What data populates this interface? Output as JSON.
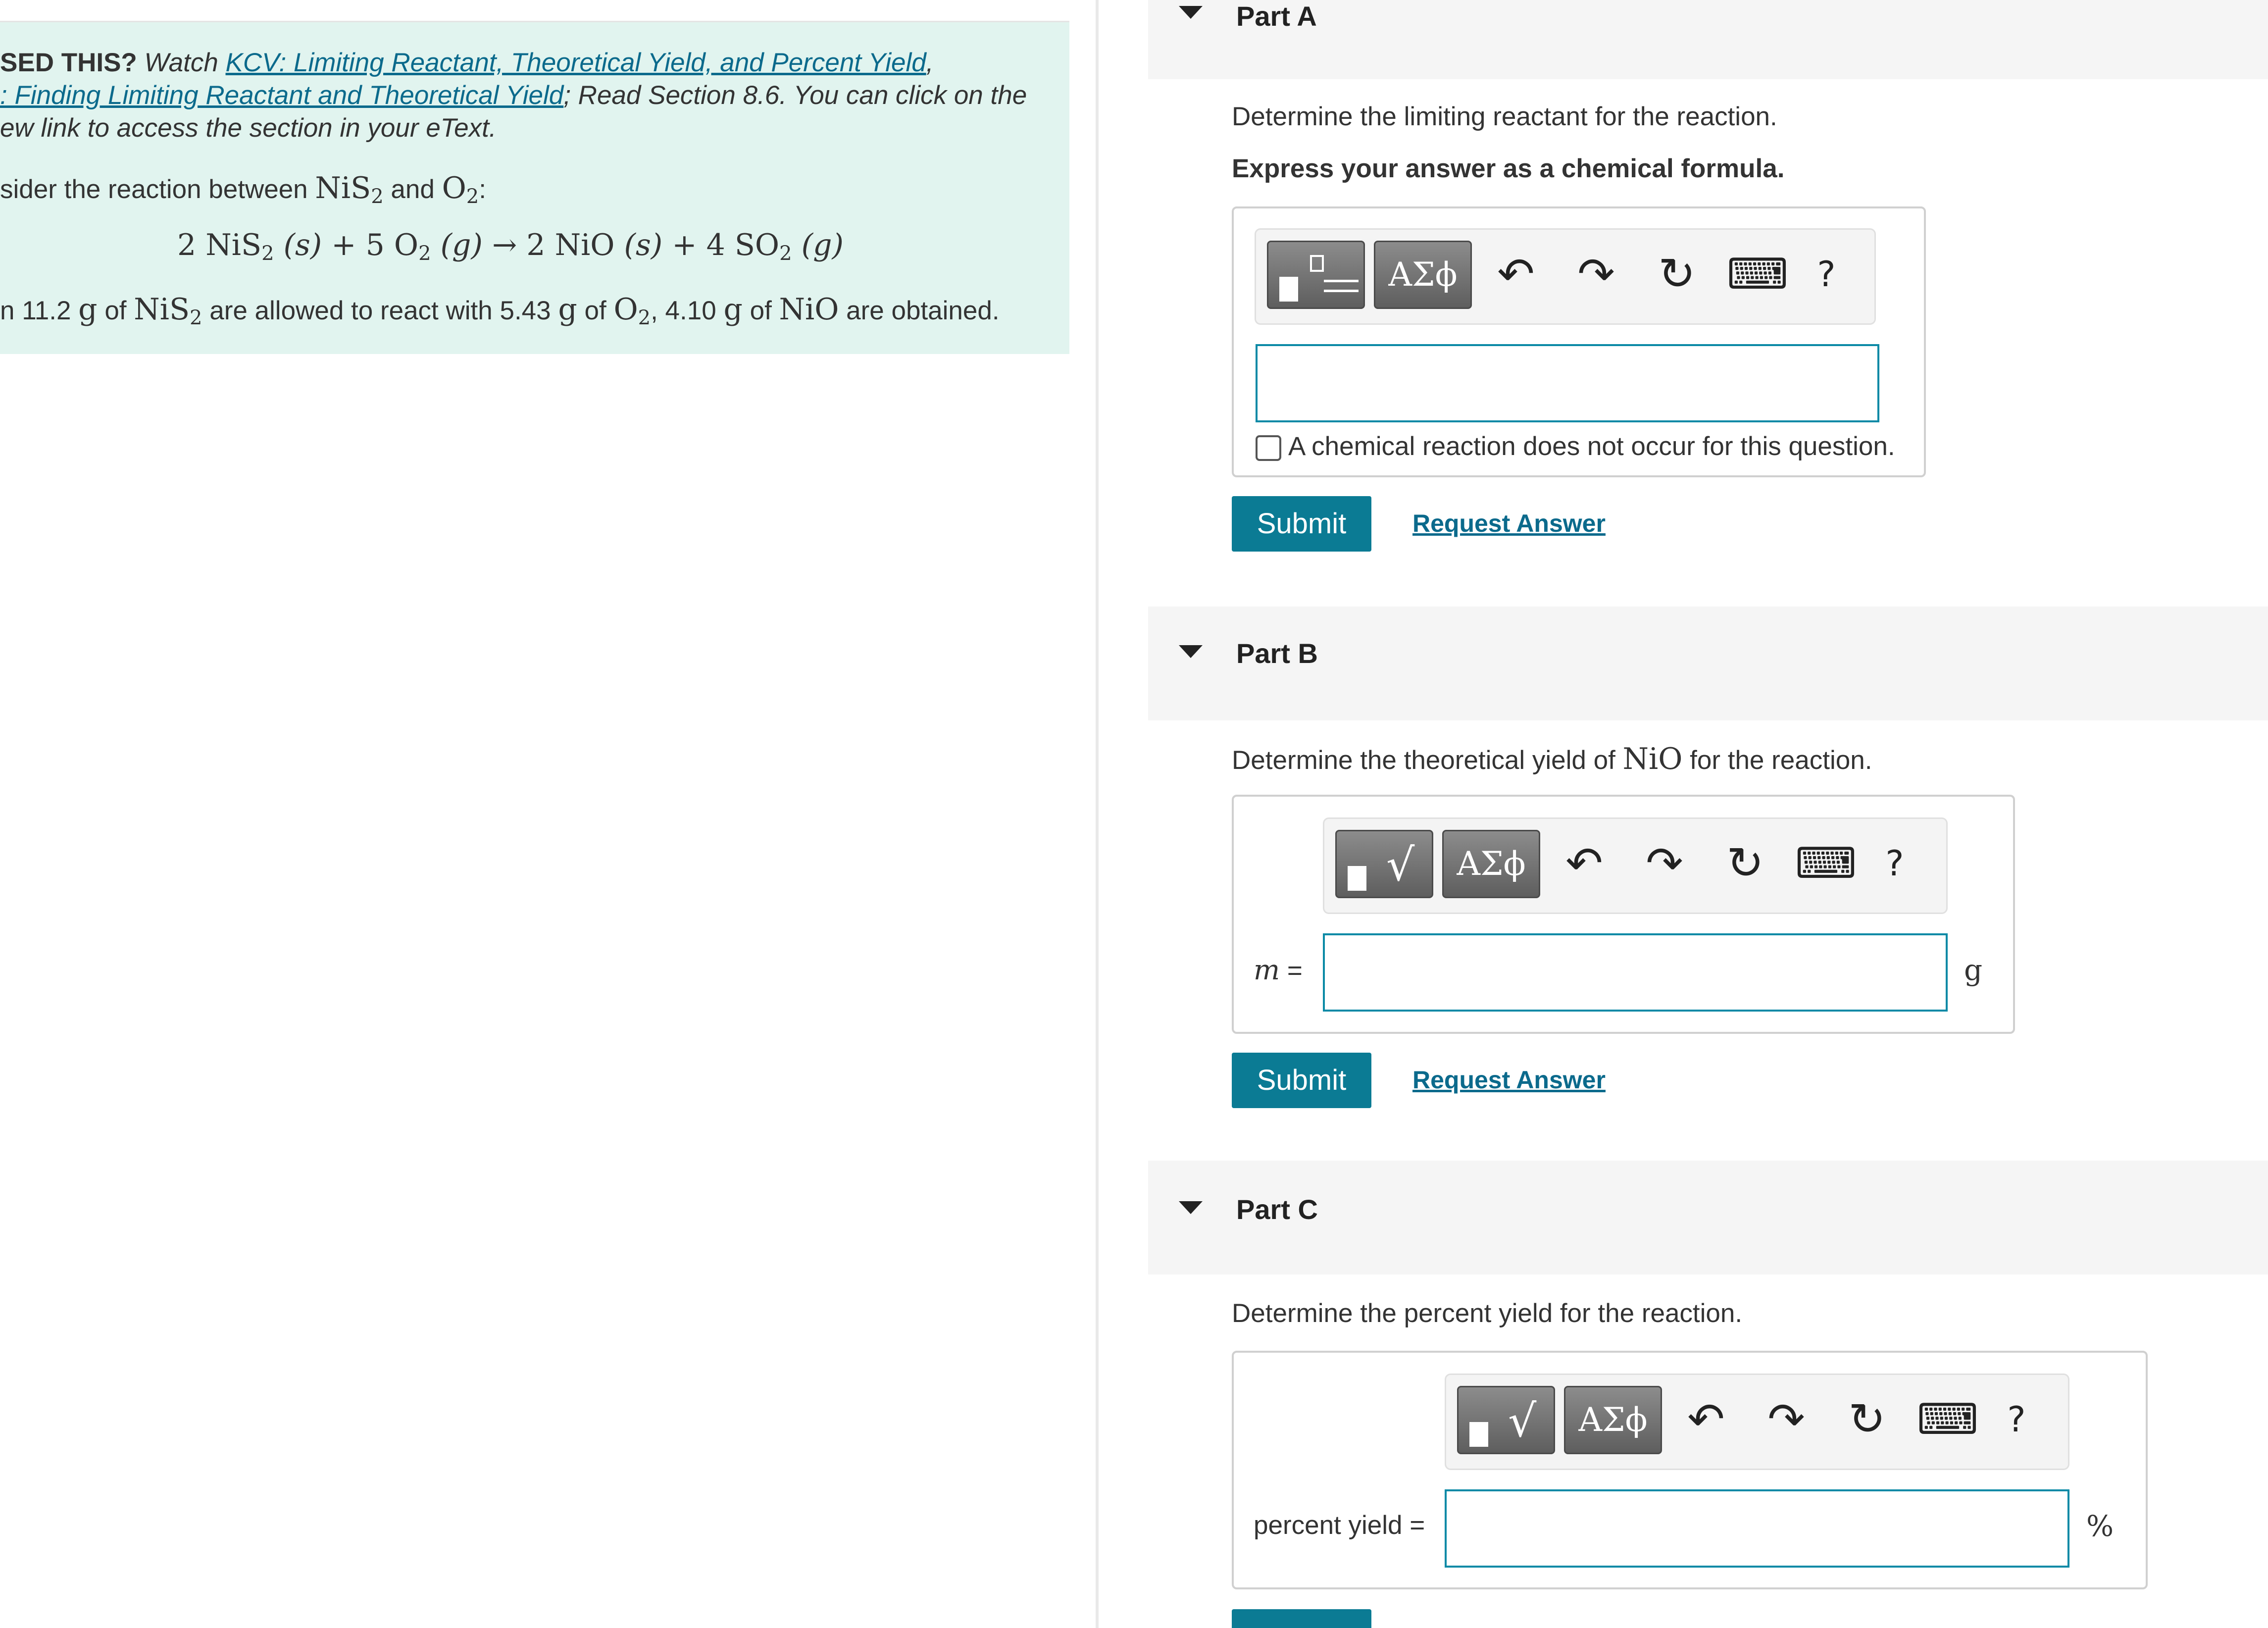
{
  "intro": {
    "lead": "SED THIS?",
    "watch": "Watch",
    "link1": "KCV: Limiting Reactant, Theoretical Yield, and Percent Yield",
    "comma": ",",
    "link2": ": Finding Limiting Reactant and Theoretical Yield",
    "read": "; Read Section 8.6. You can click on the",
    "line3": "ew link to access the section in your eText.",
    "consider_prefix": "sider the reaction between",
    "consider_and": "and",
    "colon": ":",
    "equation": {
      "c1": "2",
      "r1": "NiS",
      "r1sub": "2",
      "s1": "(s)",
      "c2": "+ 5",
      "r2": "O",
      "r2sub": "2",
      "s2": "(g)",
      "arrow": "→",
      "c3": "2",
      "p1": "NiO",
      "s3": "(s)",
      "c4": "+ 4",
      "p2": "SO",
      "p2sub": "2",
      "s4": "(g)"
    },
    "given": {
      "prefix": "n 11.2",
      "g1": "g",
      "of1": "of",
      "s1": "NiS",
      "s1sub": "2",
      "mid": "are allowed to react with 5.43",
      "g2": "g",
      "of2": "of",
      "s2": "O",
      "s2sub": "2",
      "mid2": ", 4.10",
      "g3": "g",
      "of3": "of",
      "s3": "NiO",
      "end": "are obtained."
    }
  },
  "parts": [
    {
      "title": "Part A",
      "question": "Determine the limiting reactant for the reaction.",
      "instruction": "Express your answer as a chemical formula.",
      "checkbox_label": "A chemical reaction does not occur for this question.",
      "submit": "Submit",
      "request": "Request Answer"
    },
    {
      "title": "Part B",
      "question_prefix": "Determine the theoretical yield of",
      "question_species": "NiO",
      "question_suffix": "for the reaction.",
      "var": "m",
      "eq": " =",
      "unit": "g",
      "submit": "Submit",
      "request": "Request Answer"
    },
    {
      "title": "Part C",
      "question": "Determine the percent yield for the reaction.",
      "var": "percent yield =",
      "unit": "%"
    }
  ],
  "toolbar": {
    "greek": "ΑΣϕ",
    "undo": "↶",
    "redo": "↷",
    "reset": "↻",
    "keyboard": "⌨",
    "help": "?",
    "sqrt": "√"
  },
  "icons": [
    "caret-down-icon",
    "template-icon",
    "greek-symbols-icon",
    "undo-icon",
    "redo-icon",
    "reset-icon",
    "keyboard-icon",
    "help-icon"
  ],
  "colors": {
    "accent": "#0b7b94",
    "link": "#0b6a8c",
    "info_bg": "#e1f4ef",
    "input_border": "#0b8aa6"
  }
}
